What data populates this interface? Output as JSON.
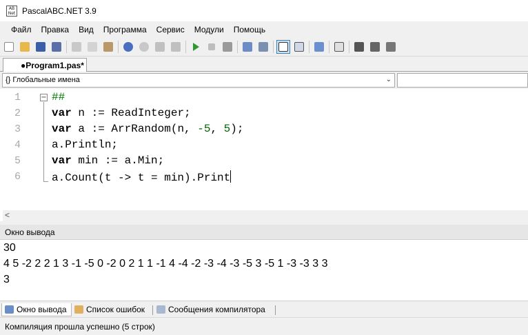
{
  "window": {
    "title": "PascalABC.NET 3.9",
    "icon": "pascalabc-app-icon"
  },
  "menu": [
    "Файл",
    "Правка",
    "Вид",
    "Программа",
    "Сервис",
    "Модули",
    "Помощь"
  ],
  "toolbar": {
    "buttons": [
      "new-file-icon",
      "open-folder-icon",
      "save-icon",
      "save-all-icon",
      "cut-icon",
      "copy-icon",
      "paste-icon",
      "undo-icon",
      "redo-icon",
      "navigate-back-icon",
      "navigate-forward-icon",
      "run-icon",
      "stop-icon",
      "compile-icon",
      "debug-step-into-icon",
      "debug-step-over-icon",
      "console-output-icon",
      "form-designer-icon",
      "properties-icon",
      "code-templates-icon",
      "tool-1-icon",
      "tool-2-icon",
      "tool-3-icon"
    ]
  },
  "editor": {
    "tab_label": "●Program1.pas*",
    "scope": "Глобальные имена",
    "line_numbers": [
      "1",
      "2",
      "3",
      "4",
      "5",
      "6"
    ],
    "lines": [
      {
        "comment": "##"
      },
      {
        "kw": "var",
        "rest": " n := ReadInteger;"
      },
      {
        "kw": "var",
        "pre": " a := ArrRandom(n, ",
        "n1": "-5",
        "mid": ", ",
        "n2": "5",
        "post": ");"
      },
      {
        "text": "a.Println;"
      },
      {
        "kw": "var",
        "rest": " min := a.Min;"
      },
      {
        "text": "a.Count(t -> t = min).Print"
      }
    ]
  },
  "output": {
    "title": "Окно вывода",
    "lines": [
      "30",
      "4 5 -2 2 2 1 3 -1 -5 0 -2 0 2 1 1 -1 4 -4 -2 -3 -4 -3 -5 3 -5 1 -3 -3 3 3",
      "3"
    ]
  },
  "bottom_tabs": [
    "Окно вывода",
    "Список ошибок",
    "Сообщения компилятора"
  ],
  "status": "Компиляция прошла успешно (5 строк)",
  "colors": {
    "keyword": "#000000",
    "comment": "#008000",
    "number": "#006400",
    "line_number": "#a8a8a8"
  }
}
